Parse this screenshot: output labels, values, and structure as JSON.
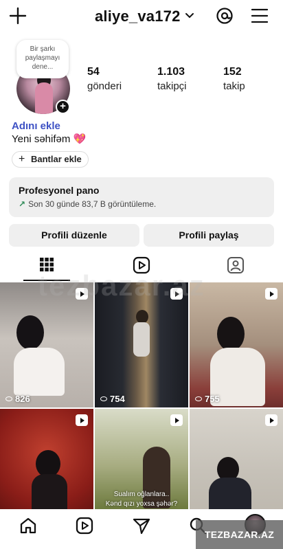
{
  "header": {
    "username": "aliye_va172"
  },
  "profile": {
    "note_bubble": "Bir şarkı paylaşmayı dene...",
    "add_name": "Adını ekle",
    "bio": "Yeni səhifəm 💖",
    "bands_button": "Bantlar ekle"
  },
  "stats": [
    {
      "value": "54",
      "label": "gönderi"
    },
    {
      "value": "1.103",
      "label": "takipçi"
    },
    {
      "value": "152",
      "label": "takip"
    }
  ],
  "dashboard": {
    "title": "Profesyonel pano",
    "subtitle": "Son 30 günde 83,7 B görüntüleme."
  },
  "actions": {
    "edit": "Profili düzenle",
    "share": "Profili paylaş"
  },
  "tabs": [
    {
      "icon": "grid-icon",
      "active": true
    },
    {
      "icon": "reels-icon",
      "active": false
    },
    {
      "icon": "tagged-icon",
      "active": false
    }
  ],
  "posts": [
    {
      "views": "826",
      "caption": ""
    },
    {
      "views": "754",
      "caption": ""
    },
    {
      "views": "755",
      "caption": ""
    },
    {
      "views": "",
      "caption": ""
    },
    {
      "views": "",
      "caption": "Sualım oğlanlara..\nKənd qızı yoxsa şəhər?"
    },
    {
      "views": "",
      "caption": ""
    }
  ],
  "bottom_nav": [
    "home-icon",
    "reels-icon",
    "send-icon",
    "search-icon",
    "profile-icon"
  ],
  "watermark": "TEZBAZAR.AZ",
  "watermark_overlay": "tezbazar.az"
}
